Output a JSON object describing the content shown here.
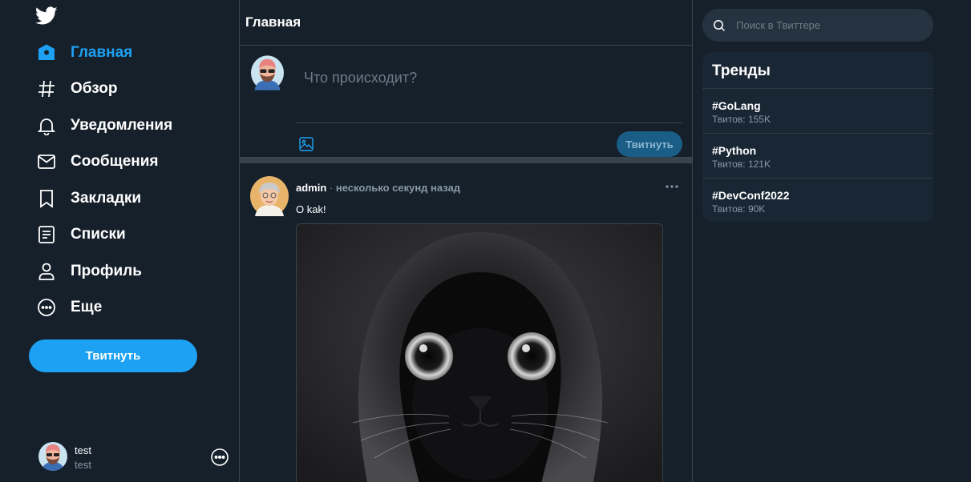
{
  "sidebar": {
    "logo_icon": "twitter-bird-icon",
    "nav": [
      {
        "label": "Главная",
        "icon": "home-icon",
        "active": true
      },
      {
        "label": "Обзор",
        "icon": "hashtag-icon"
      },
      {
        "label": "Уведомления",
        "icon": "bell-icon"
      },
      {
        "label": "Сообщения",
        "icon": "envelope-icon"
      },
      {
        "label": "Закладки",
        "icon": "bookmark-icon"
      },
      {
        "label": "Списки",
        "icon": "list-icon"
      },
      {
        "label": "Профиль",
        "icon": "user-icon"
      },
      {
        "label": "Еще",
        "icon": "more-circle-icon"
      }
    ],
    "tweet_button": "Твитнуть",
    "account": {
      "name": "test",
      "handle": "test"
    }
  },
  "main": {
    "title": "Главная",
    "composer": {
      "placeholder": "Что происходит?",
      "button": "Твитнуть"
    },
    "tweet": {
      "author": "admin",
      "separator": "·",
      "time": "несколько секунд назад",
      "text": "O kak!"
    }
  },
  "right": {
    "search_placeholder": "Поиск в Твиттере",
    "trends_title": "Тренды",
    "trends": [
      {
        "tag": "#GoLang",
        "count": "Твитов: 155K"
      },
      {
        "tag": "#Python",
        "count": "Твитов: 121K"
      },
      {
        "tag": "#DevConf2022",
        "count": "Твитов: 90K"
      }
    ]
  },
  "colors": {
    "background": "#15202b",
    "accent": "#1da1f2",
    "muted": "#8899a6",
    "border": "#38444d"
  }
}
